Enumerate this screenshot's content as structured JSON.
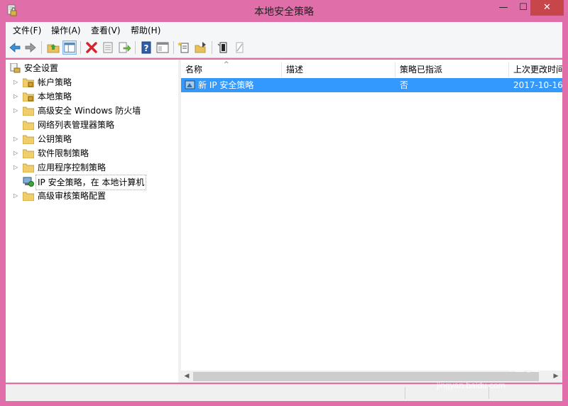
{
  "window": {
    "title": "本地安全策略",
    "controls": {
      "minimize": "—",
      "maximize": "☐",
      "close": "✕"
    }
  },
  "menubar": {
    "items": [
      {
        "label": "文件(F)"
      },
      {
        "label": "操作(A)"
      },
      {
        "label": "查看(V)"
      },
      {
        "label": "帮助(H)"
      }
    ]
  },
  "toolbar": {
    "buttons": [
      {
        "icon": "back-arrow-icon"
      },
      {
        "icon": "forward-arrow-icon"
      },
      {
        "icon": "up-folder-icon"
      },
      {
        "icon": "show-hide-tree-icon",
        "active": true
      },
      {
        "icon": "delete-icon"
      },
      {
        "icon": "properties-icon"
      },
      {
        "icon": "export-list-icon"
      },
      {
        "icon": "help-icon"
      },
      {
        "icon": "show-console-tree-icon"
      },
      {
        "icon": "create-ip-policy-icon"
      },
      {
        "icon": "manage-filter-icon"
      },
      {
        "icon": "assign-icon"
      },
      {
        "icon": "unassign-icon"
      }
    ]
  },
  "tree": {
    "root": {
      "label": "安全设置"
    },
    "items": [
      {
        "label": "帐户策略",
        "expandable": true,
        "icon": "locked-folder-icon"
      },
      {
        "label": "本地策略",
        "expandable": true,
        "icon": "locked-folder-icon"
      },
      {
        "label": "高级安全 Windows 防火墙",
        "expandable": true,
        "icon": "folder-icon"
      },
      {
        "label": "网络列表管理器策略",
        "expandable": false,
        "icon": "folder-icon"
      },
      {
        "label": "公钥策略",
        "expandable": true,
        "icon": "folder-icon"
      },
      {
        "label": "软件限制策略",
        "expandable": true,
        "icon": "folder-icon"
      },
      {
        "label": "应用程序控制策略",
        "expandable": true,
        "icon": "folder-icon"
      },
      {
        "label": "IP 安全策略，在 本地计算机",
        "expandable": false,
        "icon": "ip-security-icon",
        "selected": true
      },
      {
        "label": "高级审核策略配置",
        "expandable": true,
        "icon": "folder-icon"
      }
    ]
  },
  "list": {
    "columns": [
      {
        "label": "名称"
      },
      {
        "label": "描述"
      },
      {
        "label": "策略已指派"
      },
      {
        "label": "上次更改时间"
      }
    ],
    "rows": [
      {
        "name": "新 IP 安全策略",
        "description": "",
        "assigned": "否",
        "modified": "2017-10-16"
      }
    ]
  },
  "watermark": {
    "logo": "Baidu",
    "cn": "经验",
    "url": "jingyan.baidu.com"
  },
  "colors": {
    "frame": "#e06fa9",
    "selection": "#3399ff",
    "close_button": "#c7464a"
  }
}
